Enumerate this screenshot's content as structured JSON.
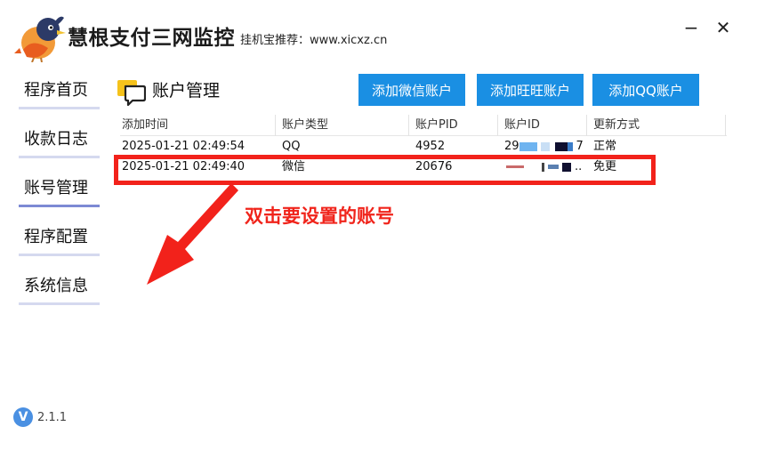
{
  "window": {
    "title": "慧根支付三网监控",
    "subtitle": "挂机宝推荐：www.xicxz.cn",
    "minimize_glyph": "−",
    "close_glyph": "✕"
  },
  "sidebar": {
    "items": [
      {
        "label": "程序首页",
        "active": false
      },
      {
        "label": "收款日志",
        "active": false
      },
      {
        "label": "账号管理",
        "active": true
      },
      {
        "label": "程序配置",
        "active": false
      },
      {
        "label": "系统信息",
        "active": false
      }
    ],
    "version": "2.1.1",
    "version_icon": "V"
  },
  "section": {
    "title": "账户管理",
    "icon": "chat-bubble-icon"
  },
  "buttons": {
    "add_wechat": "添加微信账户",
    "add_wangwang": "添加旺旺账户",
    "add_qq": "添加QQ账户"
  },
  "table": {
    "columns": [
      "添加时间",
      "账户类型",
      "账户PID",
      "账户ID",
      "更新方式"
    ],
    "rows": [
      {
        "time": "2025-01-21 02:49:54",
        "type": "QQ",
        "pid": "4952",
        "id_visible": "29",
        "id_tail": "7",
        "mode": "正常"
      },
      {
        "time": "2025-01-21 02:49:40",
        "type": "微信",
        "pid": "20676",
        "id_visible": "",
        "id_tail": "..",
        "mode": "免更"
      }
    ]
  },
  "annotation": {
    "text": "双击要设置的账号",
    "color": "#f0241b"
  },
  "colors": {
    "accent_button": "#1a8fe3",
    "nav_active_underline": "#7d8ad4",
    "nav_underline": "#d5d9ef",
    "annotation_red": "#f2221b"
  }
}
